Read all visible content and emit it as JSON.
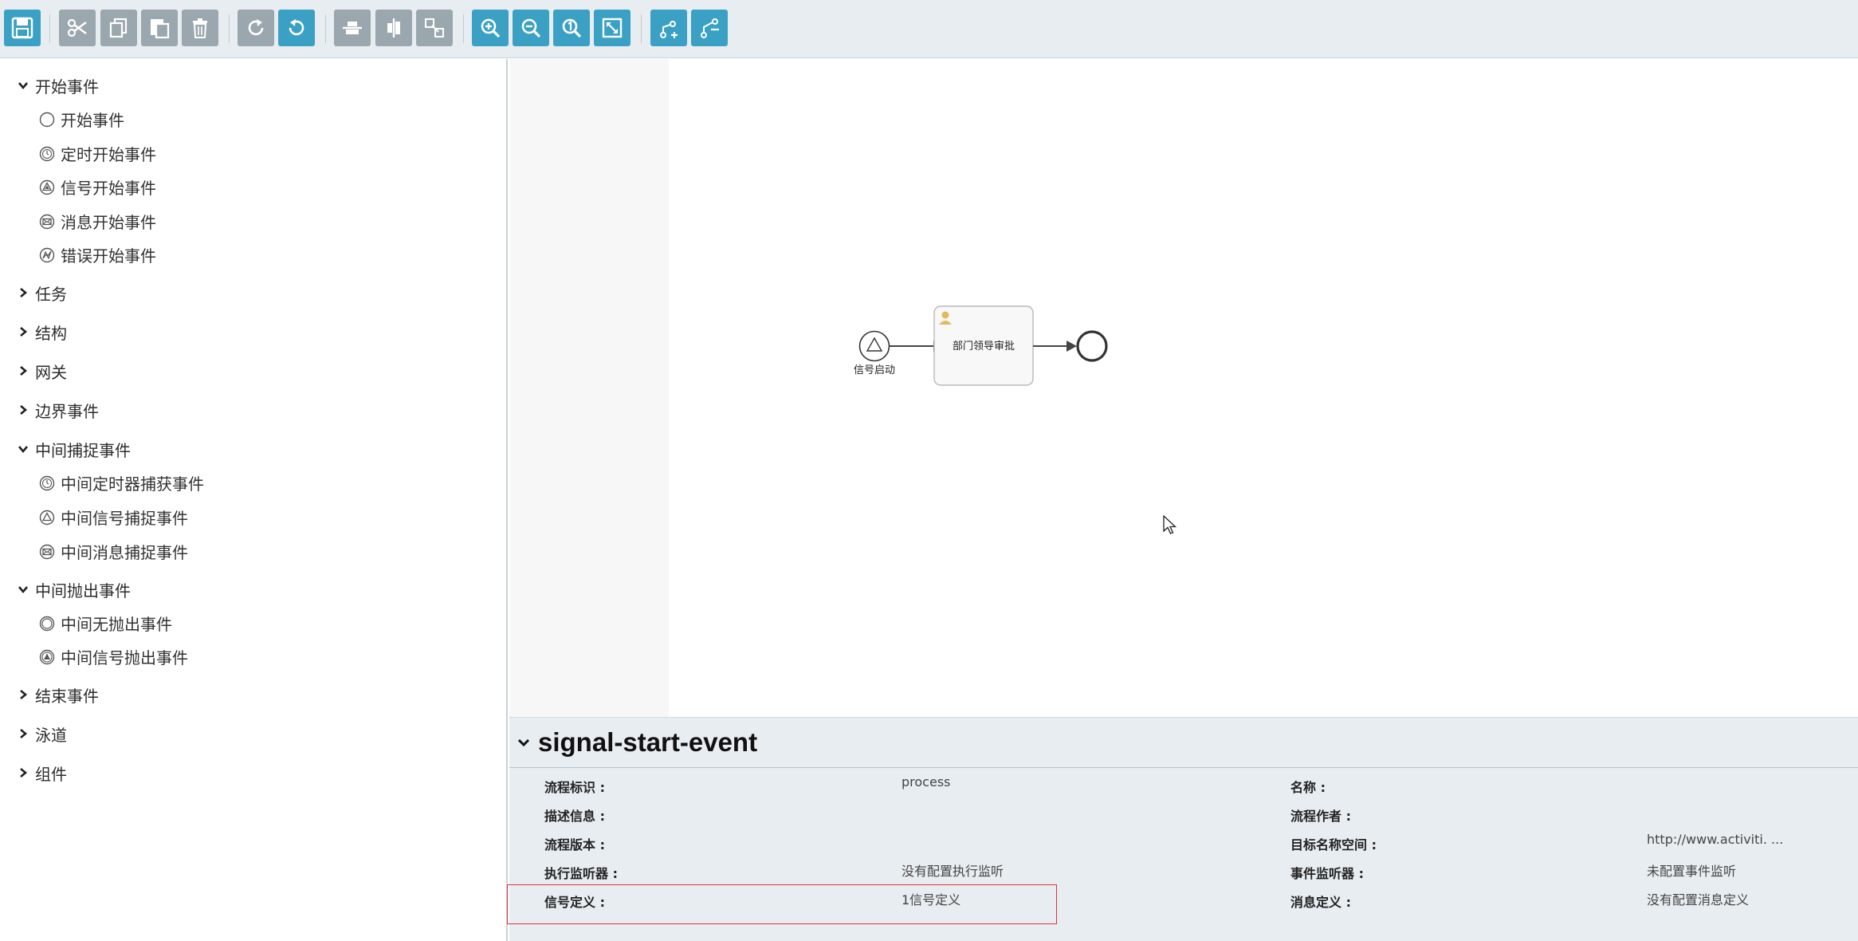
{
  "toolbar": {
    "buttons": [
      {
        "id": "save",
        "icon": "save-icon",
        "color": "#3aa1c4"
      },
      {
        "id": "cut",
        "icon": "cut-icon",
        "color": "#9ba7ae"
      },
      {
        "id": "copy",
        "icon": "copy-icon",
        "color": "#9ba7ae"
      },
      {
        "id": "paste",
        "icon": "paste-icon",
        "color": "#9ba7ae"
      },
      {
        "id": "delete",
        "icon": "trash-icon",
        "color": "#9ba7ae"
      },
      {
        "id": "redo",
        "icon": "redo-icon",
        "color": "#9ba7ae"
      },
      {
        "id": "undo",
        "icon": "undo-icon",
        "color": "#3aa1c4"
      },
      {
        "id": "align-horizontal",
        "icon": "align-horizontal-icon",
        "color": "#9ba7ae"
      },
      {
        "id": "align-vertical",
        "icon": "align-vertical-icon",
        "color": "#9ba7ae"
      },
      {
        "id": "same-size",
        "icon": "same-size-icon",
        "color": "#9ba7ae"
      },
      {
        "id": "zoom-in",
        "icon": "zoom-in-icon",
        "color": "#3aa1c4"
      },
      {
        "id": "zoom-out",
        "icon": "zoom-out-icon",
        "color": "#3aa1c4"
      },
      {
        "id": "zoom-actual",
        "icon": "zoom-actual-icon",
        "color": "#3aa1c4"
      },
      {
        "id": "zoom-fit",
        "icon": "zoom-fit-icon",
        "color": "#3aa1c4"
      },
      {
        "id": "add-bendpoint",
        "icon": "add-bendpoint-icon",
        "color": "#3aa1c4"
      },
      {
        "id": "remove-bendpoint",
        "icon": "remove-bendpoint-icon",
        "color": "#3aa1c4"
      }
    ]
  },
  "palette": {
    "groups": [
      {
        "label": "开始事件",
        "expanded": true,
        "items": [
          {
            "label": "开始事件",
            "icon": "start-event-icon"
          },
          {
            "label": "定时开始事件",
            "icon": "timer-start-event-icon"
          },
          {
            "label": "信号开始事件",
            "icon": "signal-start-event-icon"
          },
          {
            "label": "消息开始事件",
            "icon": "message-start-event-icon"
          },
          {
            "label": "错误开始事件",
            "icon": "error-start-event-icon"
          }
        ]
      },
      {
        "label": "任务",
        "expanded": false,
        "items": []
      },
      {
        "label": "结构",
        "expanded": false,
        "items": []
      },
      {
        "label": "网关",
        "expanded": false,
        "items": []
      },
      {
        "label": "边界事件",
        "expanded": false,
        "items": []
      },
      {
        "label": "中间捕捉事件",
        "expanded": true,
        "items": [
          {
            "label": "中间定时器捕获事件",
            "icon": "timer-catch-event-icon"
          },
          {
            "label": "中间信号捕捉事件",
            "icon": "signal-catch-event-icon"
          },
          {
            "label": "中间消息捕捉事件",
            "icon": "message-catch-event-icon"
          }
        ]
      },
      {
        "label": "中间抛出事件",
        "expanded": true,
        "items": [
          {
            "label": "中间无抛出事件",
            "icon": "none-throw-event-icon"
          },
          {
            "label": "中间信号抛出事件",
            "icon": "signal-throw-event-icon"
          }
        ]
      },
      {
        "label": "结束事件",
        "expanded": false,
        "items": []
      },
      {
        "label": "泳道",
        "expanded": false,
        "items": []
      },
      {
        "label": "组件",
        "expanded": false,
        "items": []
      }
    ]
  },
  "diagram": {
    "start_label": "信号启动",
    "task_label": "部门领导审批"
  },
  "properties": {
    "title": "signal-start-event",
    "left": [
      {
        "label": "流程标识 :",
        "value": "process"
      },
      {
        "label": "描述信息 :",
        "value": ""
      },
      {
        "label": "流程版本 :",
        "value": ""
      },
      {
        "label": "执行监听器 :",
        "value": "没有配置执行监听"
      },
      {
        "label": "信号定义 :",
        "value": "1信号定义"
      }
    ],
    "right": [
      {
        "label": "名称 :",
        "value": ""
      },
      {
        "label": "流程作者 :",
        "value": ""
      },
      {
        "label": "目标名称空间 :",
        "value": "http://www.activiti. ..."
      },
      {
        "label": "事件监听器 :",
        "value": "未配置事件监听"
      },
      {
        "label": "消息定义 :",
        "value": "没有配置消息定义"
      }
    ]
  },
  "colors": {
    "accent": "#3aa1c4",
    "disabled": "#9ba7ae",
    "highlight": "#e0333c"
  }
}
